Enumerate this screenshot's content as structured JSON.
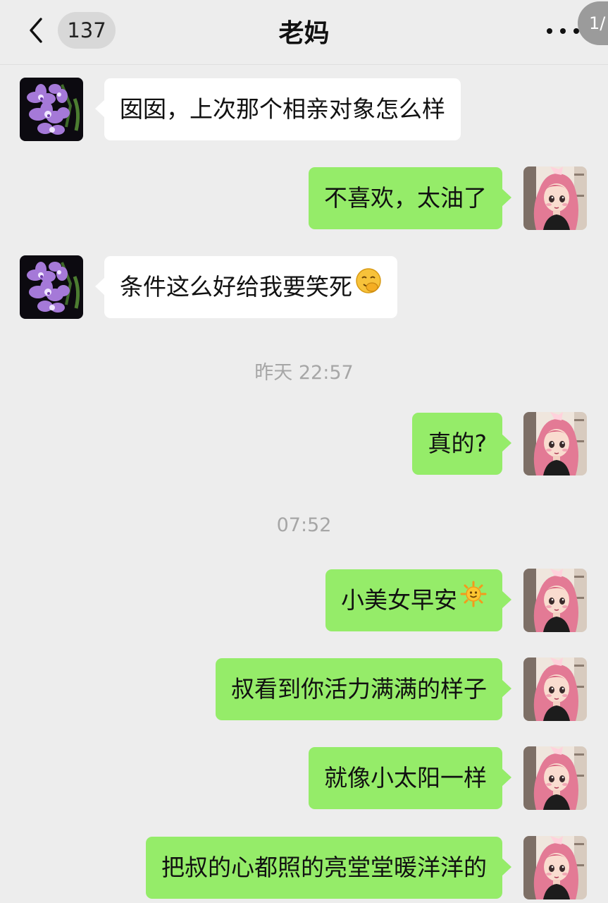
{
  "header": {
    "unread_count": "137",
    "title": "老妈",
    "page_indicator": "1/"
  },
  "messages": [
    {
      "sender": "mom",
      "text": "囡囡，上次那个相亲对象怎么样"
    },
    {
      "sender": "me",
      "text": "不喜欢，太油了"
    },
    {
      "sender": "mom",
      "text": "条件这么好给我要笑死",
      "emoji": "blush-laugh-emoji"
    },
    {
      "sender": "me",
      "text": "真的?"
    },
    {
      "sender": "me",
      "text": "小美女早安",
      "emoji": "sun-emoji"
    },
    {
      "sender": "me",
      "text": "叔看到你活力满满的样子"
    },
    {
      "sender": "me",
      "text": "就像小太阳一样"
    },
    {
      "sender": "me",
      "text": "把叔的心都照的亮堂堂暖洋洋的"
    }
  ],
  "timestamps": [
    "昨天 22:57",
    "07:52"
  ],
  "colors": {
    "background": "#ededed",
    "bubble_received": "#ffffff",
    "bubble_sent": "#95ec69",
    "timestamp_text": "#a6a6a6"
  },
  "icons": {
    "back": "chevron-left-icon",
    "more": "more-dots-icon",
    "mom_avatar": "purple-orchid-avatar",
    "my_avatar": "pink-hair-girl-avatar"
  }
}
